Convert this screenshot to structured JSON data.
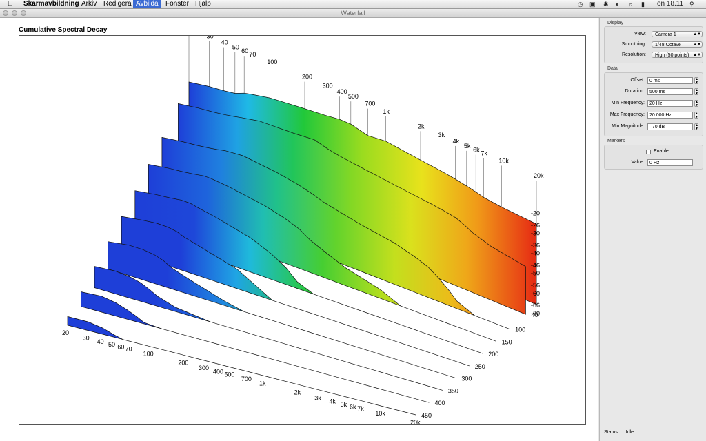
{
  "menubar": {
    "apple_icon": "apple-logo",
    "app_name": "Skärmavbildning",
    "items": [
      "Arkiv",
      "Redigera",
      "Avbilda",
      "Fönster",
      "Hjälp"
    ],
    "active_item": "Avbilda",
    "clock": "on 18.11"
  },
  "window": {
    "title": "Waterfall"
  },
  "chart_title": "Cumulative Spectral Decay",
  "chart_data": {
    "type": "area",
    "title": "Cumulative Spectral Decay",
    "x_ticks": [
      "20",
      "30",
      "40",
      "50",
      "60",
      "70",
      "100",
      "200",
      "300",
      "400",
      "500",
      "700",
      "1k",
      "2k",
      "3k",
      "4k",
      "5k",
      "6k",
      "7k",
      "10k",
      "20k"
    ],
    "x_tick_values": [
      20,
      30,
      40,
      50,
      60,
      70,
      100,
      200,
      300,
      400,
      500,
      700,
      1000,
      2000,
      3000,
      4000,
      5000,
      6000,
      7000,
      10000,
      20000
    ],
    "z_ticks": [
      "40",
      "100",
      "150",
      "200",
      "250",
      "300",
      "350",
      "400",
      "450"
    ],
    "y_ticks": [
      "-20",
      "-26",
      "-30",
      "-36",
      "-40",
      "-46",
      "-50",
      "-56",
      "-60",
      "-66",
      "-70"
    ],
    "xlim": [
      20,
      20000
    ],
    "ylim": [
      -70,
      -20
    ],
    "x_scale": "log",
    "colormap": [
      "#1e3fd8",
      "#1fb9e6",
      "#21c83a",
      "#9bdc1f",
      "#e8e21c",
      "#f09a18",
      "#e62a14"
    ],
    "series": [
      {
        "time": 0,
        "values": [
          -34,
          -32,
          -31,
          -30,
          -28,
          -27,
          -25,
          -23,
          -22,
          -21,
          -21,
          -23,
          -22,
          -24,
          -25,
          -26,
          -27,
          -28,
          -29,
          -30,
          -31
        ]
      },
      {
        "time": 40,
        "values": [
          -36,
          -34,
          -33,
          -32,
          -31,
          -30,
          -28,
          -27,
          -26,
          -28,
          -29,
          -30,
          -31,
          -33,
          -34,
          -35,
          -36,
          -38,
          -40,
          -43,
          -46
        ]
      },
      {
        "time": 100,
        "values": [
          -40,
          -38,
          -37,
          -36,
          -35,
          -34,
          -33,
          -35,
          -37,
          -39,
          -41,
          -43,
          -45,
          -48,
          -51,
          -54,
          -58,
          -62,
          -66,
          -70,
          -70
        ]
      },
      {
        "time": 150,
        "values": [
          -43,
          -41,
          -40,
          -39,
          -38,
          -38,
          -39,
          -42,
          -45,
          -48,
          -52,
          -56,
          -60,
          -65,
          -70,
          -70,
          -70,
          -70,
          -70,
          -70,
          -70
        ]
      },
      {
        "time": 200,
        "values": [
          -46,
          -44,
          -43,
          -42,
          -42,
          -43,
          -45,
          -50,
          -55,
          -60,
          -66,
          -70,
          -70,
          -70,
          -70,
          -70,
          -70,
          -70,
          -70,
          -70,
          -70
        ]
      },
      {
        "time": 250,
        "values": [
          -49,
          -47,
          -46,
          -46,
          -47,
          -49,
          -52,
          -58,
          -65,
          -70,
          -70,
          -70,
          -70,
          -70,
          -70,
          -70,
          -70,
          -70,
          -70,
          -70,
          -70
        ]
      },
      {
        "time": 300,
        "values": [
          -52,
          -50,
          -50,
          -51,
          -53,
          -56,
          -60,
          -67,
          -70,
          -70,
          -70,
          -70,
          -70,
          -70,
          -70,
          -70,
          -70,
          -70,
          -70,
          -70,
          -70
        ]
      },
      {
        "time": 350,
        "values": [
          -55,
          -54,
          -55,
          -57,
          -60,
          -63,
          -67,
          -70,
          -70,
          -70,
          -70,
          -70,
          -70,
          -70,
          -70,
          -70,
          -70,
          -70,
          -70,
          -70,
          -70
        ]
      },
      {
        "time": 400,
        "values": [
          -59,
          -58,
          -60,
          -63,
          -66,
          -69,
          -70,
          -70,
          -70,
          -70,
          -70,
          -70,
          -70,
          -70,
          -70,
          -70,
          -70,
          -70,
          -70,
          -70,
          -70
        ]
      },
      {
        "time": 450,
        "values": [
          -63,
          -63,
          -65,
          -68,
          -70,
          -70,
          -70,
          -70,
          -70,
          -70,
          -70,
          -70,
          -70,
          -70,
          -70,
          -70,
          -70,
          -70,
          -70,
          -70,
          -70
        ]
      }
    ]
  },
  "display": {
    "title": "Display",
    "view_label": "View:",
    "view_value": "Camera 1",
    "smoothing_label": "Smoothing:",
    "smoothing_value": "1/48 Octave",
    "resolution_label": "Resolution:",
    "resolution_value": "High (50 points)"
  },
  "data": {
    "title": "Data",
    "offset_label": "Offset:",
    "offset_value": "0 ms",
    "duration_label": "Duration:",
    "duration_value": "500 ms",
    "minfreq_label": "Min Frequency:",
    "minfreq_value": "20 Hz",
    "maxfreq_label": "Max Frequency:",
    "maxfreq_value": "20 000 Hz",
    "minmag_label": "Min Magnitude:",
    "minmag_value": "–70 dB"
  },
  "markers": {
    "title": "Markers",
    "enable_label": "Enable",
    "enable_checked": false,
    "value_label": "Value:",
    "value_value": "0 Hz"
  },
  "status": {
    "label": "Status:",
    "value": "Idle"
  }
}
